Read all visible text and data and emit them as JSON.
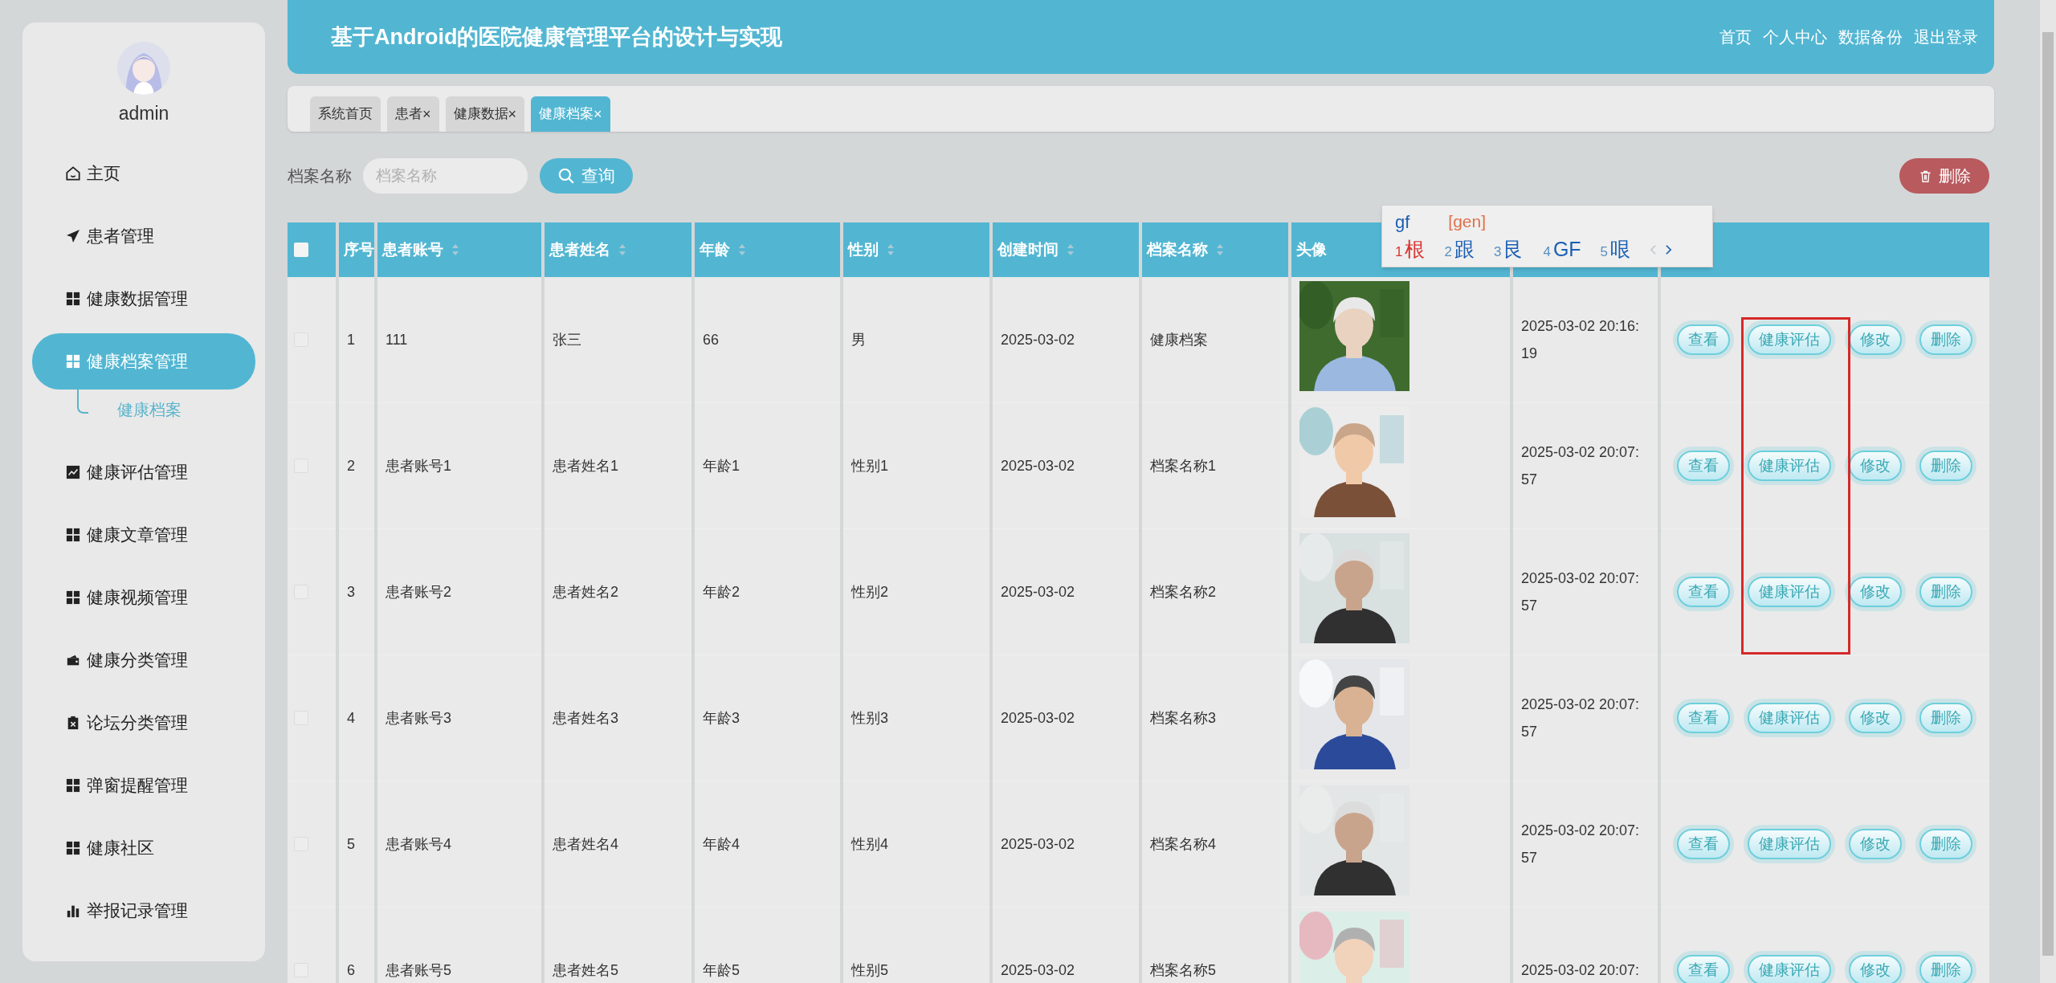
{
  "sidebar": {
    "user": "admin",
    "items": [
      {
        "label": "主页",
        "selected": false
      },
      {
        "label": "患者管理",
        "selected": false
      },
      {
        "label": "健康数据管理",
        "selected": false
      },
      {
        "label": "健康档案管理",
        "selected": true,
        "children": [
          {
            "label": "健康档案",
            "selected": true
          }
        ]
      },
      {
        "label": "健康评估管理",
        "selected": false
      },
      {
        "label": "健康文章管理",
        "selected": false
      },
      {
        "label": "健康视频管理",
        "selected": false
      },
      {
        "label": "健康分类管理",
        "selected": false
      },
      {
        "label": "论坛分类管理",
        "selected": false
      },
      {
        "label": "弹窗提醒管理",
        "selected": false
      },
      {
        "label": "健康社区",
        "selected": false
      },
      {
        "label": "举报记录管理",
        "selected": false
      }
    ]
  },
  "header": {
    "title": "基于Android的医院健康管理平台的设计与实现",
    "links": [
      "首页",
      "个人中心",
      "数据备份",
      "退出登录"
    ]
  },
  "tabs": [
    {
      "label": "系统首页",
      "closable": false,
      "selected": false
    },
    {
      "label": "患者",
      "closable": true,
      "selected": false
    },
    {
      "label": "健康数据",
      "closable": true,
      "selected": false
    },
    {
      "label": "健康档案",
      "closable": true,
      "selected": true
    }
  ],
  "tab_close": "×",
  "search": {
    "label": "档案名称",
    "placeholder": "档案名称",
    "button": "查询"
  },
  "delete_button": "删除",
  "table": {
    "select_all_checked": false,
    "columns": [
      {
        "label": "序号",
        "sortable": false
      },
      {
        "label": "患者账号",
        "sortable": true
      },
      {
        "label": "患者姓名",
        "sortable": true
      },
      {
        "label": "年龄",
        "sortable": true
      },
      {
        "label": "性别",
        "sortable": true
      },
      {
        "label": "创建时间",
        "sortable": true
      },
      {
        "label": "档案名称",
        "sortable": true
      },
      {
        "label": "头像",
        "sortable": false
      }
    ],
    "rows": [
      {
        "checked": false,
        "cells": [
          "1",
          "111",
          "张三",
          "66",
          "男",
          "2025-03-02",
          "健康档案"
        ],
        "avatar": {
          "kind": "picture"
        },
        "time": "2025-03-02 20:16:19",
        "actions": [
          "查看",
          "健康评估",
          "修改",
          "删除"
        ]
      },
      {
        "checked": false,
        "cells": [
          "2",
          "患者账号1",
          "患者姓名1",
          "年龄1",
          "性别1",
          "2025-03-02",
          "档案名称1"
        ],
        "avatar": {
          "kind": "picture"
        },
        "time": "2025-03-02 20:07:57",
        "actions": [
          "查看",
          "健康评估",
          "修改",
          "删除"
        ]
      },
      {
        "checked": false,
        "cells": [
          "3",
          "患者账号2",
          "患者姓名2",
          "年龄2",
          "性别2",
          "2025-03-02",
          "档案名称2"
        ],
        "avatar": {
          "kind": "picture"
        },
        "time": "2025-03-02 20:07:57",
        "actions": [
          "查看",
          "健康评估",
          "修改",
          "删除"
        ]
      },
      {
        "checked": false,
        "cells": [
          "4",
          "患者账号3",
          "患者姓名3",
          "年龄3",
          "性别3",
          "2025-03-02",
          "档案名称3"
        ],
        "avatar": {
          "kind": "picture"
        },
        "time": "2025-03-02 20:07:57",
        "actions": [
          "查看",
          "健康评估",
          "修改",
          "删除"
        ]
      },
      {
        "checked": false,
        "cells": [
          "5",
          "患者账号4",
          "患者姓名4",
          "年龄4",
          "性别4",
          "2025-03-02",
          "档案名称4"
        ],
        "avatar": {
          "kind": "picture"
        },
        "time": "2025-03-02 20:07:57",
        "actions": [
          "查看",
          "健康评估",
          "修改",
          "删除"
        ]
      },
      {
        "checked": false,
        "cells": [
          "6",
          "患者账号5",
          "患者姓名5",
          "年龄5",
          "性别5",
          "2025-03-02",
          "档案名称5"
        ],
        "avatar": {
          "kind": "picture"
        },
        "time": "2025-03-02 20:07:",
        "actions": [
          "查看",
          "健康评估",
          "修改",
          "删除"
        ]
      }
    ]
  },
  "ime": {
    "input": "gf",
    "pinyin": "[gen]",
    "candidates": [
      {
        "number": "1",
        "text": "根",
        "selected": true
      },
      {
        "number": "2",
        "text": "跟",
        "selected": false
      },
      {
        "number": "3",
        "text": "艮",
        "selected": false
      },
      {
        "number": "4",
        "text": "GF",
        "selected": false
      },
      {
        "number": "5",
        "text": "哏",
        "selected": false
      }
    ]
  }
}
